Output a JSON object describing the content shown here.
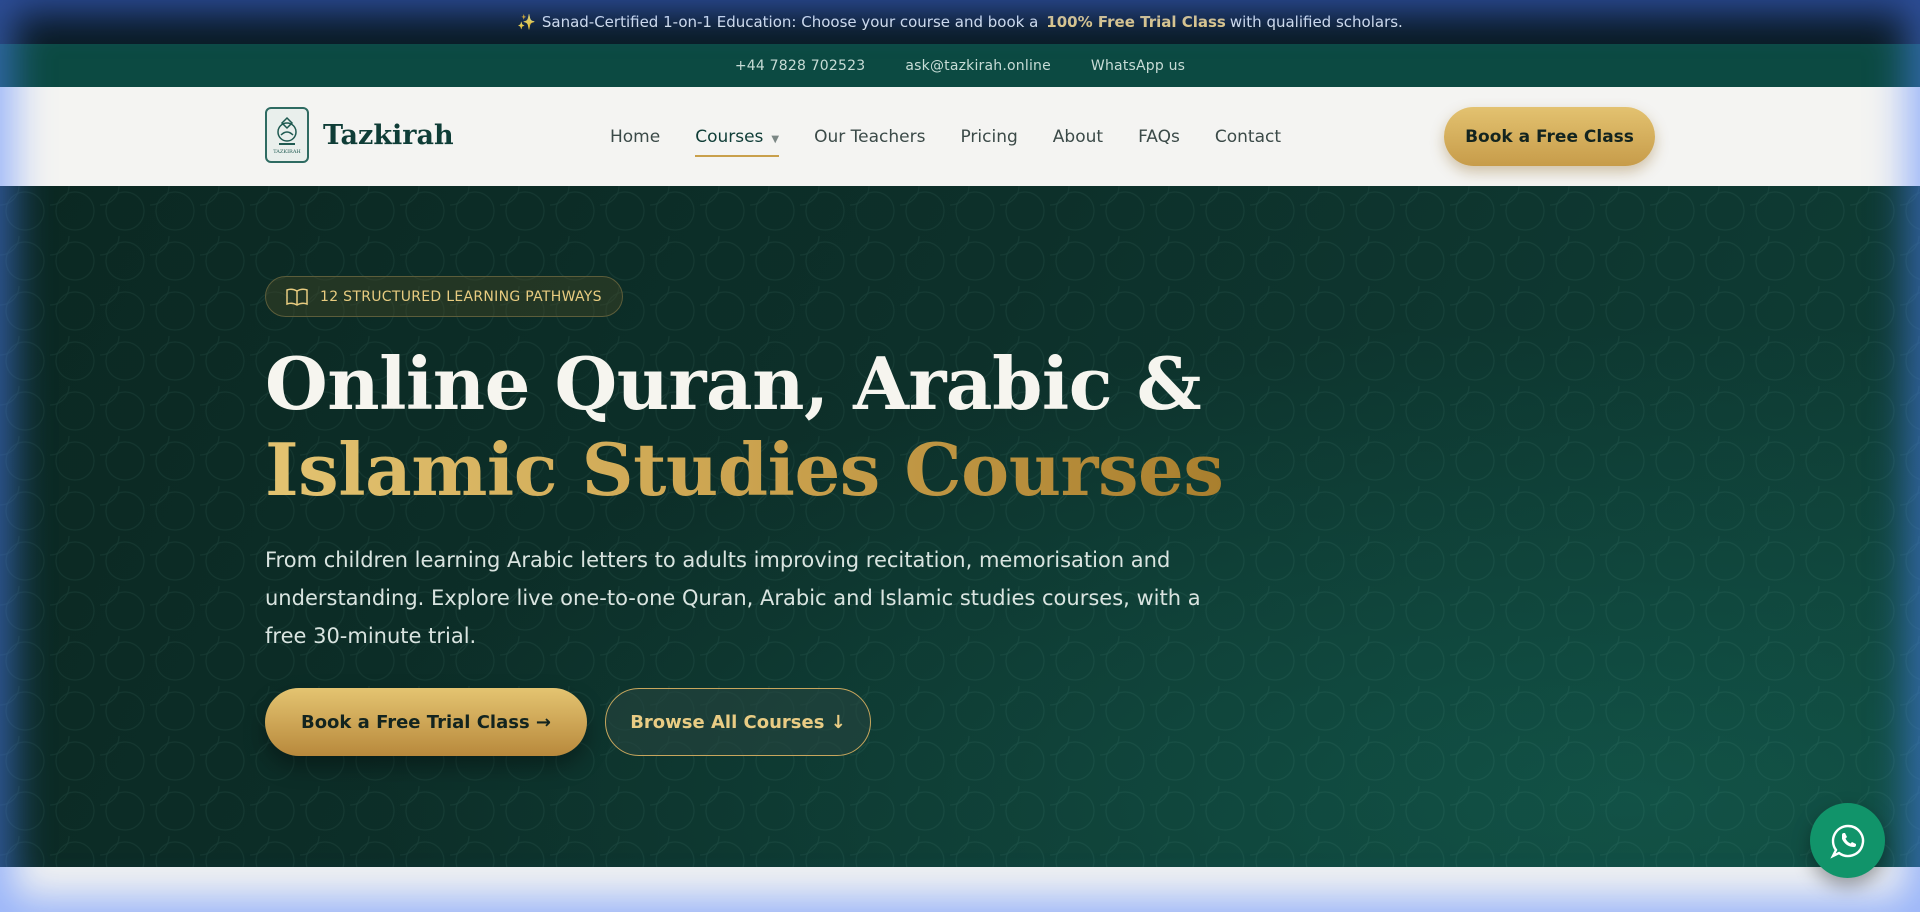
{
  "announcement": {
    "prefix": "Sanad-Certified 1-on-1 Education: Choose your course and book a",
    "highlight": "100% Free Trial Class",
    "suffix": "with qualified scholars.",
    "icon": "sparkle-icon"
  },
  "contact": {
    "phone": "+44 7828 702523",
    "email": "ask@tazkirah.online",
    "whatsapp": "WhatsApp us"
  },
  "brand": {
    "name": "Tazkirah",
    "badge_text": "TAZKIRAH"
  },
  "nav": {
    "items": [
      {
        "label": "Home"
      },
      {
        "label": "Courses",
        "active": true,
        "dropdown": true
      },
      {
        "label": "Our Teachers"
      },
      {
        "label": "Pricing"
      },
      {
        "label": "About"
      },
      {
        "label": "FAQs"
      },
      {
        "label": "Contact"
      }
    ],
    "cta": "Book a Free Class"
  },
  "hero": {
    "badge": "12 STRUCTURED LEARNING PATHWAYS",
    "title_line1": "Online Quran, Arabic &",
    "title_line2": "Islamic Studies Courses",
    "lead": "From children learning Arabic letters to adults improving recitation, memorisation and understanding. Explore live one-to-one Quran, Arabic and Islamic studies courses, with a free 30-minute trial.",
    "primary_cta": "Book a Free Trial Class →",
    "secondary_cta": "Browse All Courses ↓"
  },
  "colors": {
    "accent_gold": "#c9a04c",
    "hero_dark": "#0b2822",
    "teal": "#0c4a42",
    "whatsapp_green": "#11946a"
  },
  "icons": {
    "book": "open-book-icon",
    "whatsapp": "whatsapp-icon",
    "caret": "chevron-down-icon"
  }
}
